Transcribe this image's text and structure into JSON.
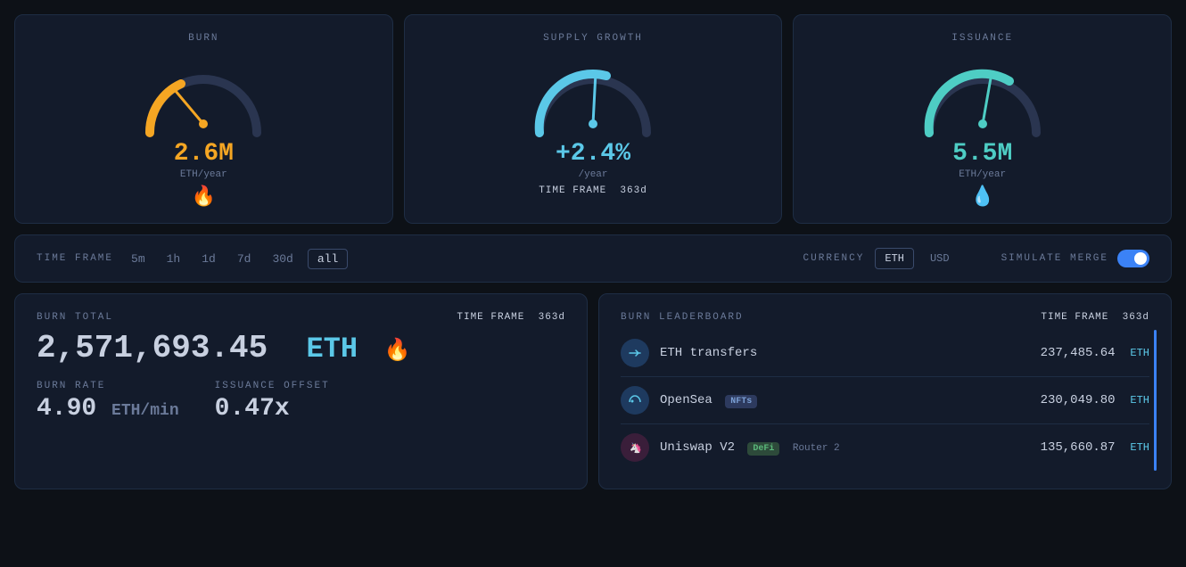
{
  "gauges": [
    {
      "id": "burn",
      "title": "BURN",
      "value": "2.6M",
      "unit": "ETH/year",
      "icon": "🔥",
      "color": "#f5a623",
      "arcColor": "#f5a623",
      "trackColor": "#2a3550",
      "needleAngle": -40,
      "arcStart": 200,
      "arcEnd": 290,
      "type": "burn"
    },
    {
      "id": "supply-growth",
      "title": "SUPPLY GROWTH",
      "value": "+2.4%",
      "unit": "/year",
      "timeframe_label": "TIME FRAME",
      "timeframe_value": "363d",
      "color": "#5bc8e8",
      "arcColor": "#5bc8e8",
      "trackColor": "#2a3550",
      "needleAngle": -5,
      "type": "supply"
    },
    {
      "id": "issuance",
      "title": "ISSUANCE",
      "value": "5.5M",
      "unit": "ETH/year",
      "icon": "💧",
      "color": "#4ecdc4",
      "arcColor": "#4ecdc4",
      "trackColor": "#2a3550",
      "needleAngle": -15,
      "type": "issuance"
    }
  ],
  "controls": {
    "timeframe_label": "TIME FRAME",
    "time_options": [
      "5m",
      "1h",
      "1d",
      "7d",
      "30d",
      "all"
    ],
    "active_time": "all",
    "currency_label": "CURRENCY",
    "currency_options": [
      "ETH",
      "USD"
    ],
    "active_currency": "ETH",
    "simulate_label": "SIMULATE MERGE"
  },
  "burn_total": {
    "label": "BURN TOTAL",
    "timeframe_label": "TIME FRAME",
    "timeframe_value": "363d",
    "value": "2,571,693.45",
    "currency": "ETH",
    "burn_rate_label": "BURN RATE",
    "burn_rate_value": "4.90",
    "burn_rate_unit": "ETH/min",
    "issuance_offset_label": "ISSUANCE OFFSET",
    "issuance_offset_value": "0.47x"
  },
  "leaderboard": {
    "label": "BURN LEADERBOARD",
    "timeframe_label": "TIME FRAME",
    "timeframe_value": "363d",
    "items": [
      {
        "name": "ETH transfers",
        "badge": null,
        "sub": null,
        "amount": "237,485.64",
        "currency": "ETH",
        "icon": "↔",
        "icon_bg": "#1e3a5f",
        "icon_color": "#5bc8e8"
      },
      {
        "name": "OpenSea",
        "badge": "NFTs",
        "badge_class": "badge-nft",
        "sub": null,
        "amount": "230,049.80",
        "currency": "ETH",
        "icon": "🌊",
        "icon_bg": "#1e3a5f",
        "icon_color": "#5bc8e8"
      },
      {
        "name": "Uniswap V2",
        "badge": "DeFi",
        "badge_class": "badge-defi",
        "sub": "Router 2",
        "amount": "135,660.87",
        "currency": "ETH",
        "icon": "🦄",
        "icon_bg": "#3a1e3a",
        "icon_color": "#c850c0"
      }
    ]
  }
}
